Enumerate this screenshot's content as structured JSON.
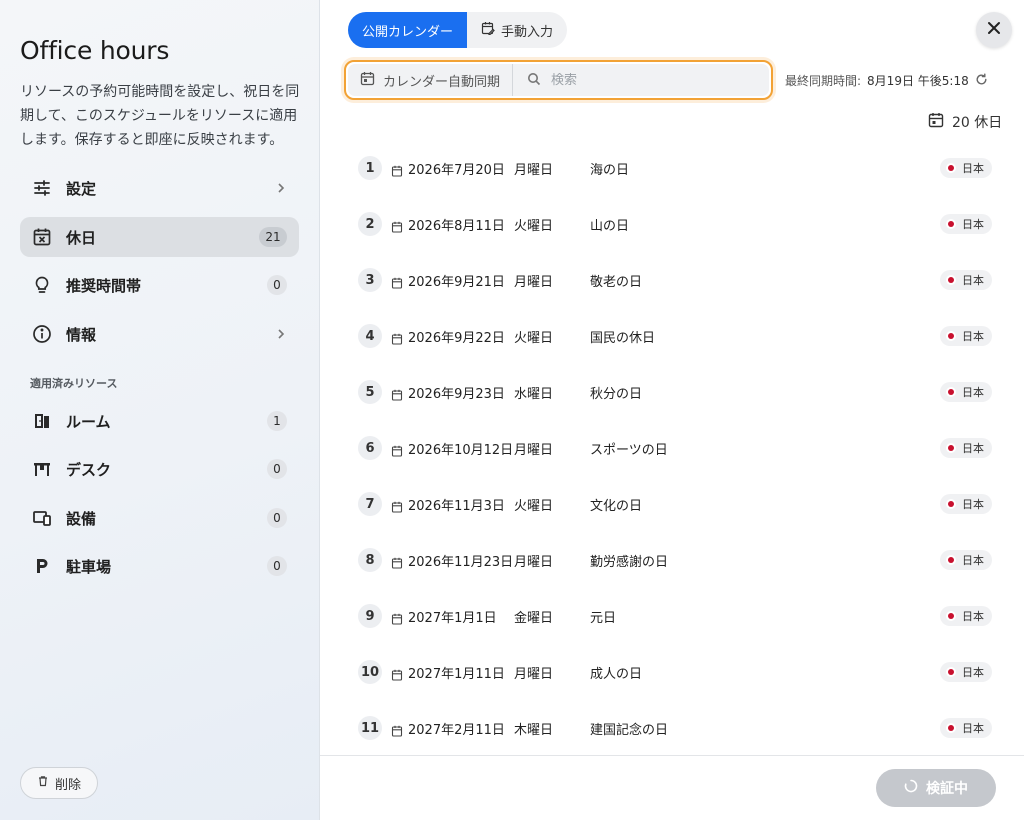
{
  "sidebar": {
    "title": "Office hours",
    "description": "リソースの予約可能時間を設定し、祝日を同期して、このスケジュールをリソースに適用します。保存すると即座に反映されます。",
    "nav": [
      {
        "label": "設定",
        "icon": "sliders-icon"
      },
      {
        "label": "休日",
        "icon": "calendar-x-icon",
        "count": "21"
      },
      {
        "label": "推奨時間帯",
        "icon": "lightbulb-icon",
        "count": "0"
      },
      {
        "label": "情報",
        "icon": "info-icon"
      }
    ],
    "section_label": "適用済みリソース",
    "resources": [
      {
        "label": "ルーム",
        "icon": "door-icon",
        "count": "1"
      },
      {
        "label": "デスク",
        "icon": "desk-icon",
        "count": "0"
      },
      {
        "label": "設備",
        "icon": "devices-icon",
        "count": "0"
      },
      {
        "label": "駐車場",
        "icon": "parking-icon",
        "count": "0"
      }
    ],
    "delete_label": "削除"
  },
  "tabs": {
    "public_calendar": "公開カレンダー",
    "manual_entry": "手動入力"
  },
  "search": {
    "auto_sync": "カレンダー自動同期",
    "placeholder": "検索"
  },
  "sync": {
    "label": "最終同期時間:",
    "time": "8月19日 午後5:18"
  },
  "holiday_total": "20 休日",
  "holidays": [
    {
      "n": "1",
      "date": "2026年7月20日",
      "weekday": "月曜日",
      "name": "海の日",
      "country": "日本"
    },
    {
      "n": "2",
      "date": "2026年8月11日",
      "weekday": "火曜日",
      "name": "山の日",
      "country": "日本"
    },
    {
      "n": "3",
      "date": "2026年9月21日",
      "weekday": "月曜日",
      "name": "敬老の日",
      "country": "日本"
    },
    {
      "n": "4",
      "date": "2026年9月22日",
      "weekday": "火曜日",
      "name": "国民の休日",
      "country": "日本"
    },
    {
      "n": "5",
      "date": "2026年9月23日",
      "weekday": "水曜日",
      "name": "秋分の日",
      "country": "日本"
    },
    {
      "n": "6",
      "date": "2026年10月12日",
      "weekday": "月曜日",
      "name": "スポーツの日",
      "country": "日本"
    },
    {
      "n": "7",
      "date": "2026年11月3日",
      "weekday": "火曜日",
      "name": "文化の日",
      "country": "日本"
    },
    {
      "n": "8",
      "date": "2026年11月23日",
      "weekday": "月曜日",
      "name": "勤労感謝の日",
      "country": "日本"
    },
    {
      "n": "9",
      "date": "2027年1月1日",
      "weekday": "金曜日",
      "name": "元日",
      "country": "日本"
    },
    {
      "n": "10",
      "date": "2027年1月11日",
      "weekday": "月曜日",
      "name": "成人の日",
      "country": "日本"
    },
    {
      "n": "11",
      "date": "2027年2月11日",
      "weekday": "木曜日",
      "name": "建国記念の日",
      "country": "日本"
    }
  ],
  "footer": {
    "verify_label": "検証中"
  },
  "colors": {
    "accent": "#1a6ff0",
    "focus_ring": "#f2a235",
    "flag_red": "#c8102e"
  }
}
